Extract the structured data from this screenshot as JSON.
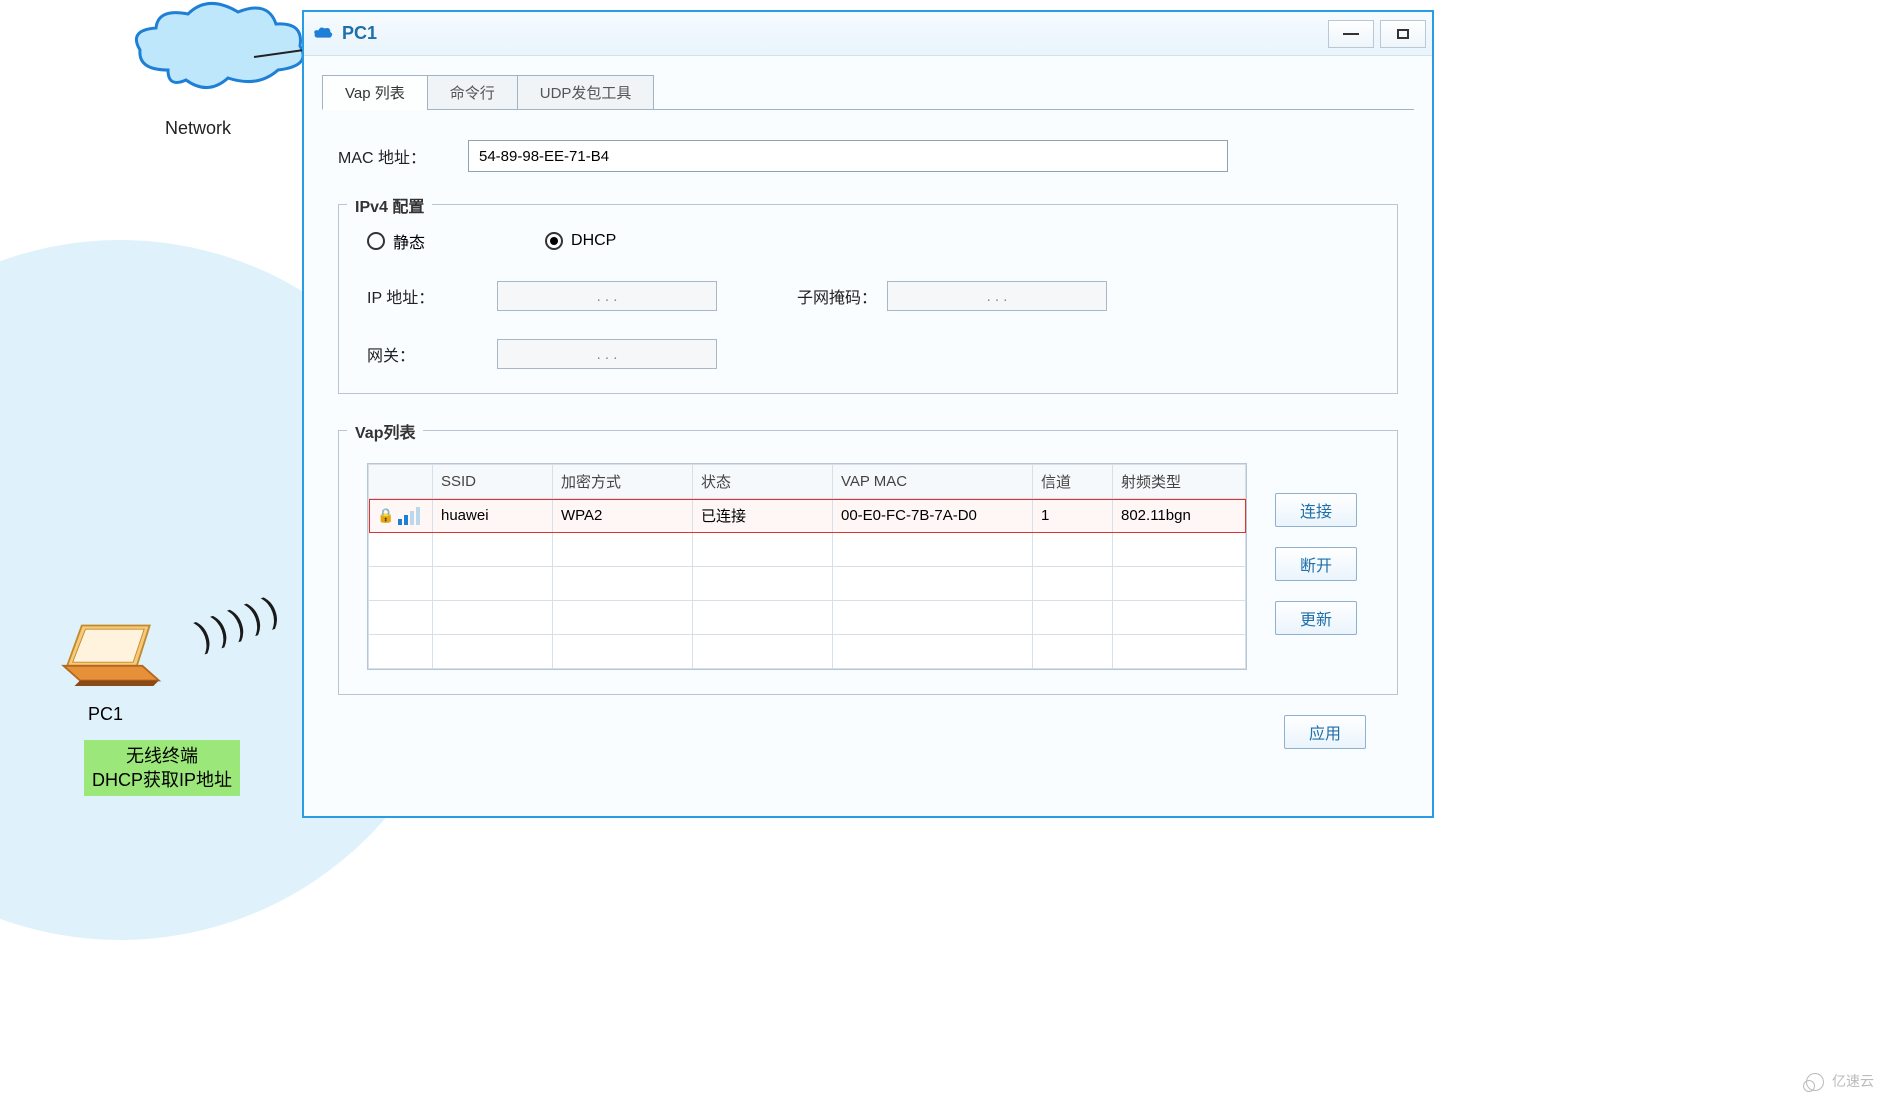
{
  "topology": {
    "cloud_label": "Network",
    "pc_label": "PC1",
    "note_line1": "无线终端",
    "note_line2": "DHCP获取IP地址"
  },
  "window": {
    "title": "PC1"
  },
  "tabs": {
    "vap_list": "Vap 列表",
    "cmd": "命令行",
    "udp": "UDP发包工具"
  },
  "mac": {
    "label": "MAC 地址：",
    "value": "54-89-98-EE-71-B4"
  },
  "ipv4": {
    "legend": "IPv4 配置",
    "radio_static": "静态",
    "radio_dhcp": "DHCP",
    "selected": "dhcp",
    "ip_label": "IP 地址：",
    "ip_value": ".       .       .",
    "mask_label": "子网掩码：",
    "mask_value": ".       .       .",
    "gw_label": "网关：",
    "gw_value": ".       .       ."
  },
  "vap": {
    "legend": "Vap列表",
    "headers": {
      "signal": "",
      "ssid": "SSID",
      "enc": "加密方式",
      "status": "状态",
      "mac": "VAP MAC",
      "channel": "信道",
      "rf": "射频类型"
    },
    "rows": [
      {
        "ssid": "huawei",
        "enc": "WPA2",
        "status": "已连接",
        "mac": "00-E0-FC-7B-7A-D0",
        "channel": "1",
        "rf": "802.11bgn",
        "selected": true
      }
    ],
    "buttons": {
      "connect": "连接",
      "disconnect": "断开",
      "refresh": "更新"
    }
  },
  "apply_button": "应用",
  "watermark": "亿速云"
}
